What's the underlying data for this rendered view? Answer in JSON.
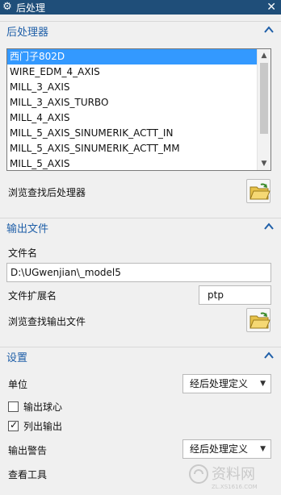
{
  "window": {
    "title": "后处理",
    "gear_icon": "gear-icon",
    "close_icon": "close-icon"
  },
  "postprocessor_section": {
    "title": "后处理器",
    "items": [
      {
        "label": "西门子802D",
        "selected": true
      },
      {
        "label": "WIRE_EDM_4_AXIS",
        "selected": false
      },
      {
        "label": "MILL_3_AXIS",
        "selected": false
      },
      {
        "label": "MILL_3_AXIS_TURBO",
        "selected": false
      },
      {
        "label": "MILL_4_AXIS",
        "selected": false
      },
      {
        "label": "MILL_5_AXIS_SINUMERIK_ACTT_IN",
        "selected": false
      },
      {
        "label": "MILL_5_AXIS_SINUMERIK_ACTT_MM",
        "selected": false
      },
      {
        "label": "MILL_5_AXIS",
        "selected": false
      }
    ],
    "browse_label": "浏览查找后处理器"
  },
  "output_section": {
    "title": "输出文件",
    "filename_label": "文件名",
    "filename_value": "D:\\UGwenjian\\_model5",
    "extension_label": "文件扩展名",
    "extension_value": "ptp",
    "browse_label": "浏览查找输出文件"
  },
  "settings_section": {
    "title": "设置",
    "unit_label": "单位",
    "unit_value": "经后处理定义",
    "output_ball_center_label": "输出球心",
    "output_ball_center_checked": false,
    "list_output_label": "列出输出",
    "list_output_checked": true,
    "output_warning_label": "输出警告",
    "output_warning_value": "经后处理定义",
    "review_tool_label": "查看工具"
  },
  "watermark": {
    "text": "资料网",
    "sub": "ZL.XS1616.COM"
  },
  "colors": {
    "title_bar": "#1f4e79",
    "section_title": "#1f5fa8",
    "selection": "#3399ff"
  }
}
